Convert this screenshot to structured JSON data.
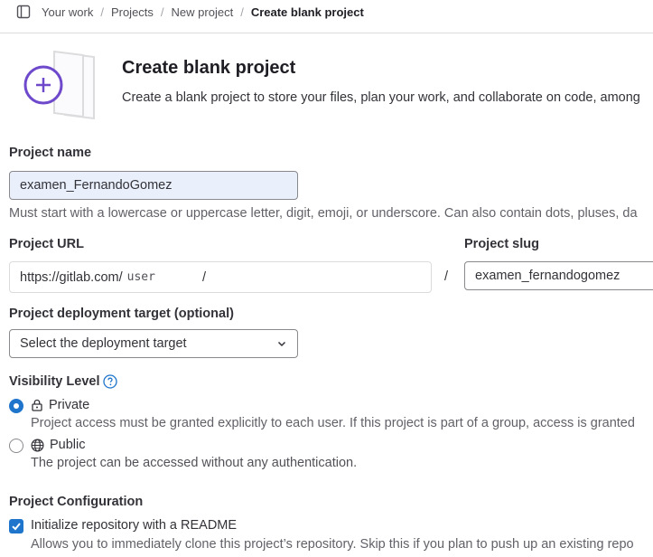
{
  "breadcrumb": {
    "items": [
      "Your work",
      "Projects",
      "New project"
    ],
    "current": "Create blank project",
    "separator": "/"
  },
  "header": {
    "title": "Create blank project",
    "description": "Create a blank project to store your files, plan your work, and collaborate on code, among"
  },
  "project_name": {
    "label": "Project name",
    "value": "examen_FernandoGomez",
    "help": "Must start with a lowercase or uppercase letter, digit, emoji, or underscore. Can also contain dots, pluses, da"
  },
  "project_url": {
    "label": "Project URL",
    "prefix": "https://gitlab.com/",
    "namespace": "user",
    "trailing": "/",
    "divider": "/"
  },
  "project_slug": {
    "label": "Project slug",
    "value": "examen_fernandogomez"
  },
  "deployment": {
    "label": "Project deployment target (optional)",
    "selected": "Select the deployment target"
  },
  "visibility": {
    "label": "Visibility Level",
    "options": [
      {
        "label": "Private",
        "icon": "lock-icon",
        "checked": true,
        "description": "Project access must be granted explicitly to each user. If this project is part of a group, access is granted"
      },
      {
        "label": "Public",
        "icon": "earth-icon",
        "checked": false,
        "description": "The project can be accessed without any authentication."
      }
    ]
  },
  "configuration": {
    "label": "Project Configuration",
    "readme": {
      "label": "Initialize repository with a README",
      "checked": true,
      "description": "Allows you to immediately clone this project’s repository. Skip this if you plan to push up an existing repo"
    }
  },
  "colors": {
    "accent": "#1f75cb",
    "illustration_purple": "#6e49cb",
    "input_fill": "#e9effb"
  }
}
